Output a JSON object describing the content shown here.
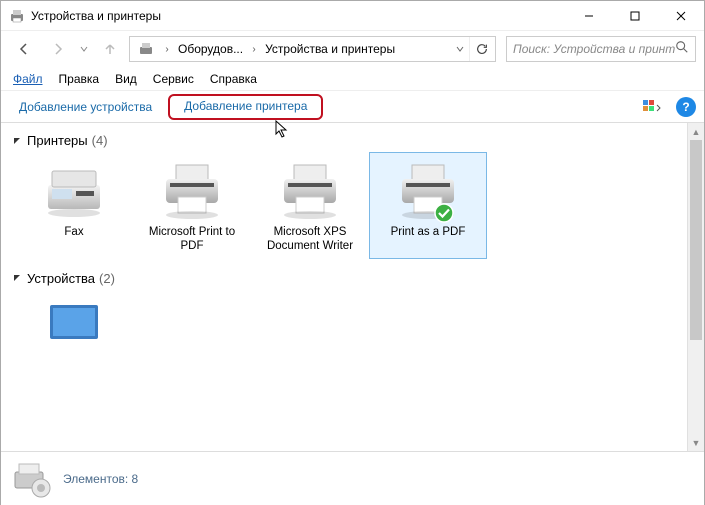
{
  "window": {
    "title": "Устройства и принтеры",
    "controls": {
      "minimize": "—",
      "maximize": "▢",
      "close": "✕"
    }
  },
  "nav": {
    "back_tooltip": "Назад",
    "forward_tooltip": "Вперёд"
  },
  "address": {
    "seg1": "Оборудов...",
    "seg2": "Устройства и принтеры"
  },
  "search": {
    "placeholder": "Поиск: Устройства и принт..."
  },
  "menu": {
    "file": "Файл",
    "edit": "Правка",
    "view": "Вид",
    "tools": "Сервис",
    "help": "Справка"
  },
  "toolbar": {
    "add_device": "Добавление устройства",
    "add_printer": "Добавление принтера"
  },
  "groups": {
    "printers": {
      "name": "Принтеры",
      "count": "(4)",
      "items": [
        {
          "label": "Fax"
        },
        {
          "label": "Microsoft Print to PDF"
        },
        {
          "label": "Microsoft XPS Document Writer"
        },
        {
          "label": "Print as a PDF"
        }
      ]
    },
    "devices": {
      "name": "Устройства",
      "count": "(2)"
    }
  },
  "status": {
    "elements_label": "Элементов:",
    "elements_count": "8"
  }
}
